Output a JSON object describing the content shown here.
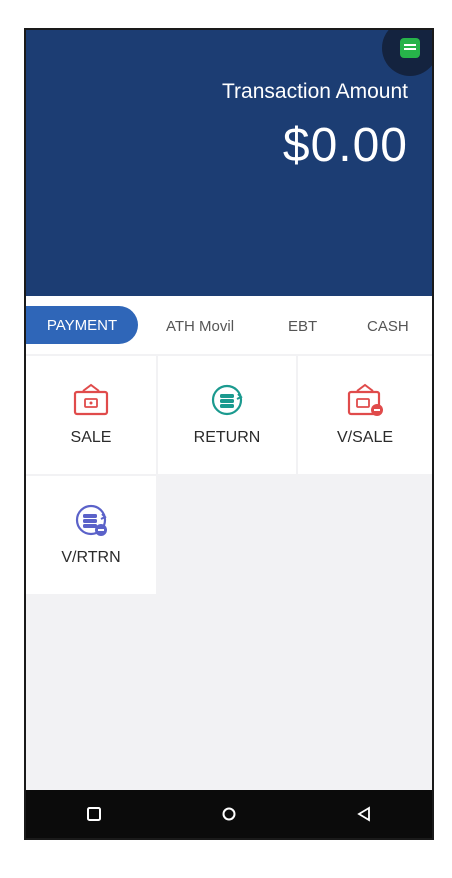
{
  "header": {
    "amount_label": "Transaction Amount",
    "amount_value": "$0.00"
  },
  "tabs": [
    {
      "label": "PAYMENT",
      "active": true
    },
    {
      "label": "ATH Movil",
      "active": false
    },
    {
      "label": "EBT",
      "active": false
    },
    {
      "label": "CASH",
      "active": false
    }
  ],
  "tiles": [
    {
      "label": "SALE",
      "icon": "wallet-icon"
    },
    {
      "label": "RETURN",
      "icon": "return-coins-icon"
    },
    {
      "label": "V/SALE",
      "icon": "void-wallet-icon"
    },
    {
      "label": "V/RTRN",
      "icon": "void-return-icon"
    }
  ],
  "colors": {
    "header_bg": "#1c3d73",
    "accent": "#2f66b8",
    "sale_red": "#e04b4b",
    "return_teal": "#1b9a8f",
    "void_blue": "#5b62c9",
    "status_green": "#27b34a"
  },
  "navbar": {
    "icons": [
      "square-icon",
      "circle-icon",
      "back-triangle-icon"
    ]
  }
}
